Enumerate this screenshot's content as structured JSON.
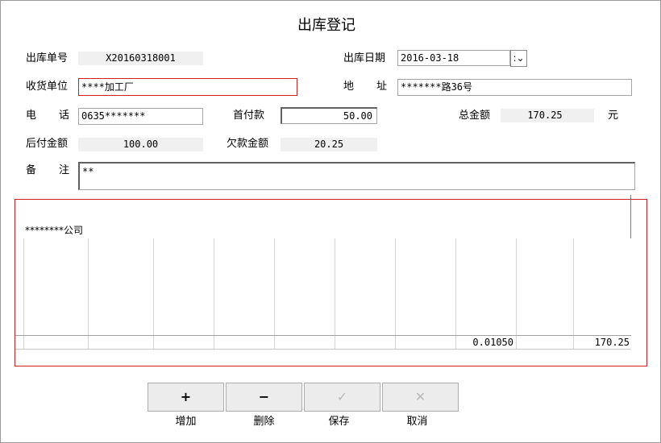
{
  "window": {
    "title": "出库登记"
  },
  "form": {
    "order_no_label": "出库单号",
    "order_no": "X20160318001",
    "date_label": "出库日期",
    "date": "2016-03-18",
    "date_dropdown": ":",
    "receiver_label": "收货单位",
    "receiver": "****加工厂",
    "address_label": "地址",
    "address": "*******路36号",
    "phone_label": "电话",
    "phone": "0635*******",
    "down_payment_label": "首付款",
    "down_payment": "50.00",
    "total_label": "总金额",
    "total": "170.25",
    "total_unit": "元",
    "later_payment_label": "后付金额",
    "later_payment": "100.00",
    "arrears_label": "欠款金额",
    "arrears": "20.25",
    "remark_label": "备注",
    "remark": "**"
  },
  "grid": {
    "company_text": "********公司",
    "footer_values": {
      "qty": "0.01050",
      "amount": "170.25"
    }
  },
  "toolbar": {
    "add": {
      "icon": "+",
      "label": "增加"
    },
    "delete": {
      "icon": "−",
      "label": "删除"
    },
    "save": {
      "icon": "✓",
      "label": "保存"
    },
    "cancel": {
      "icon": "✕",
      "label": "取消"
    }
  }
}
